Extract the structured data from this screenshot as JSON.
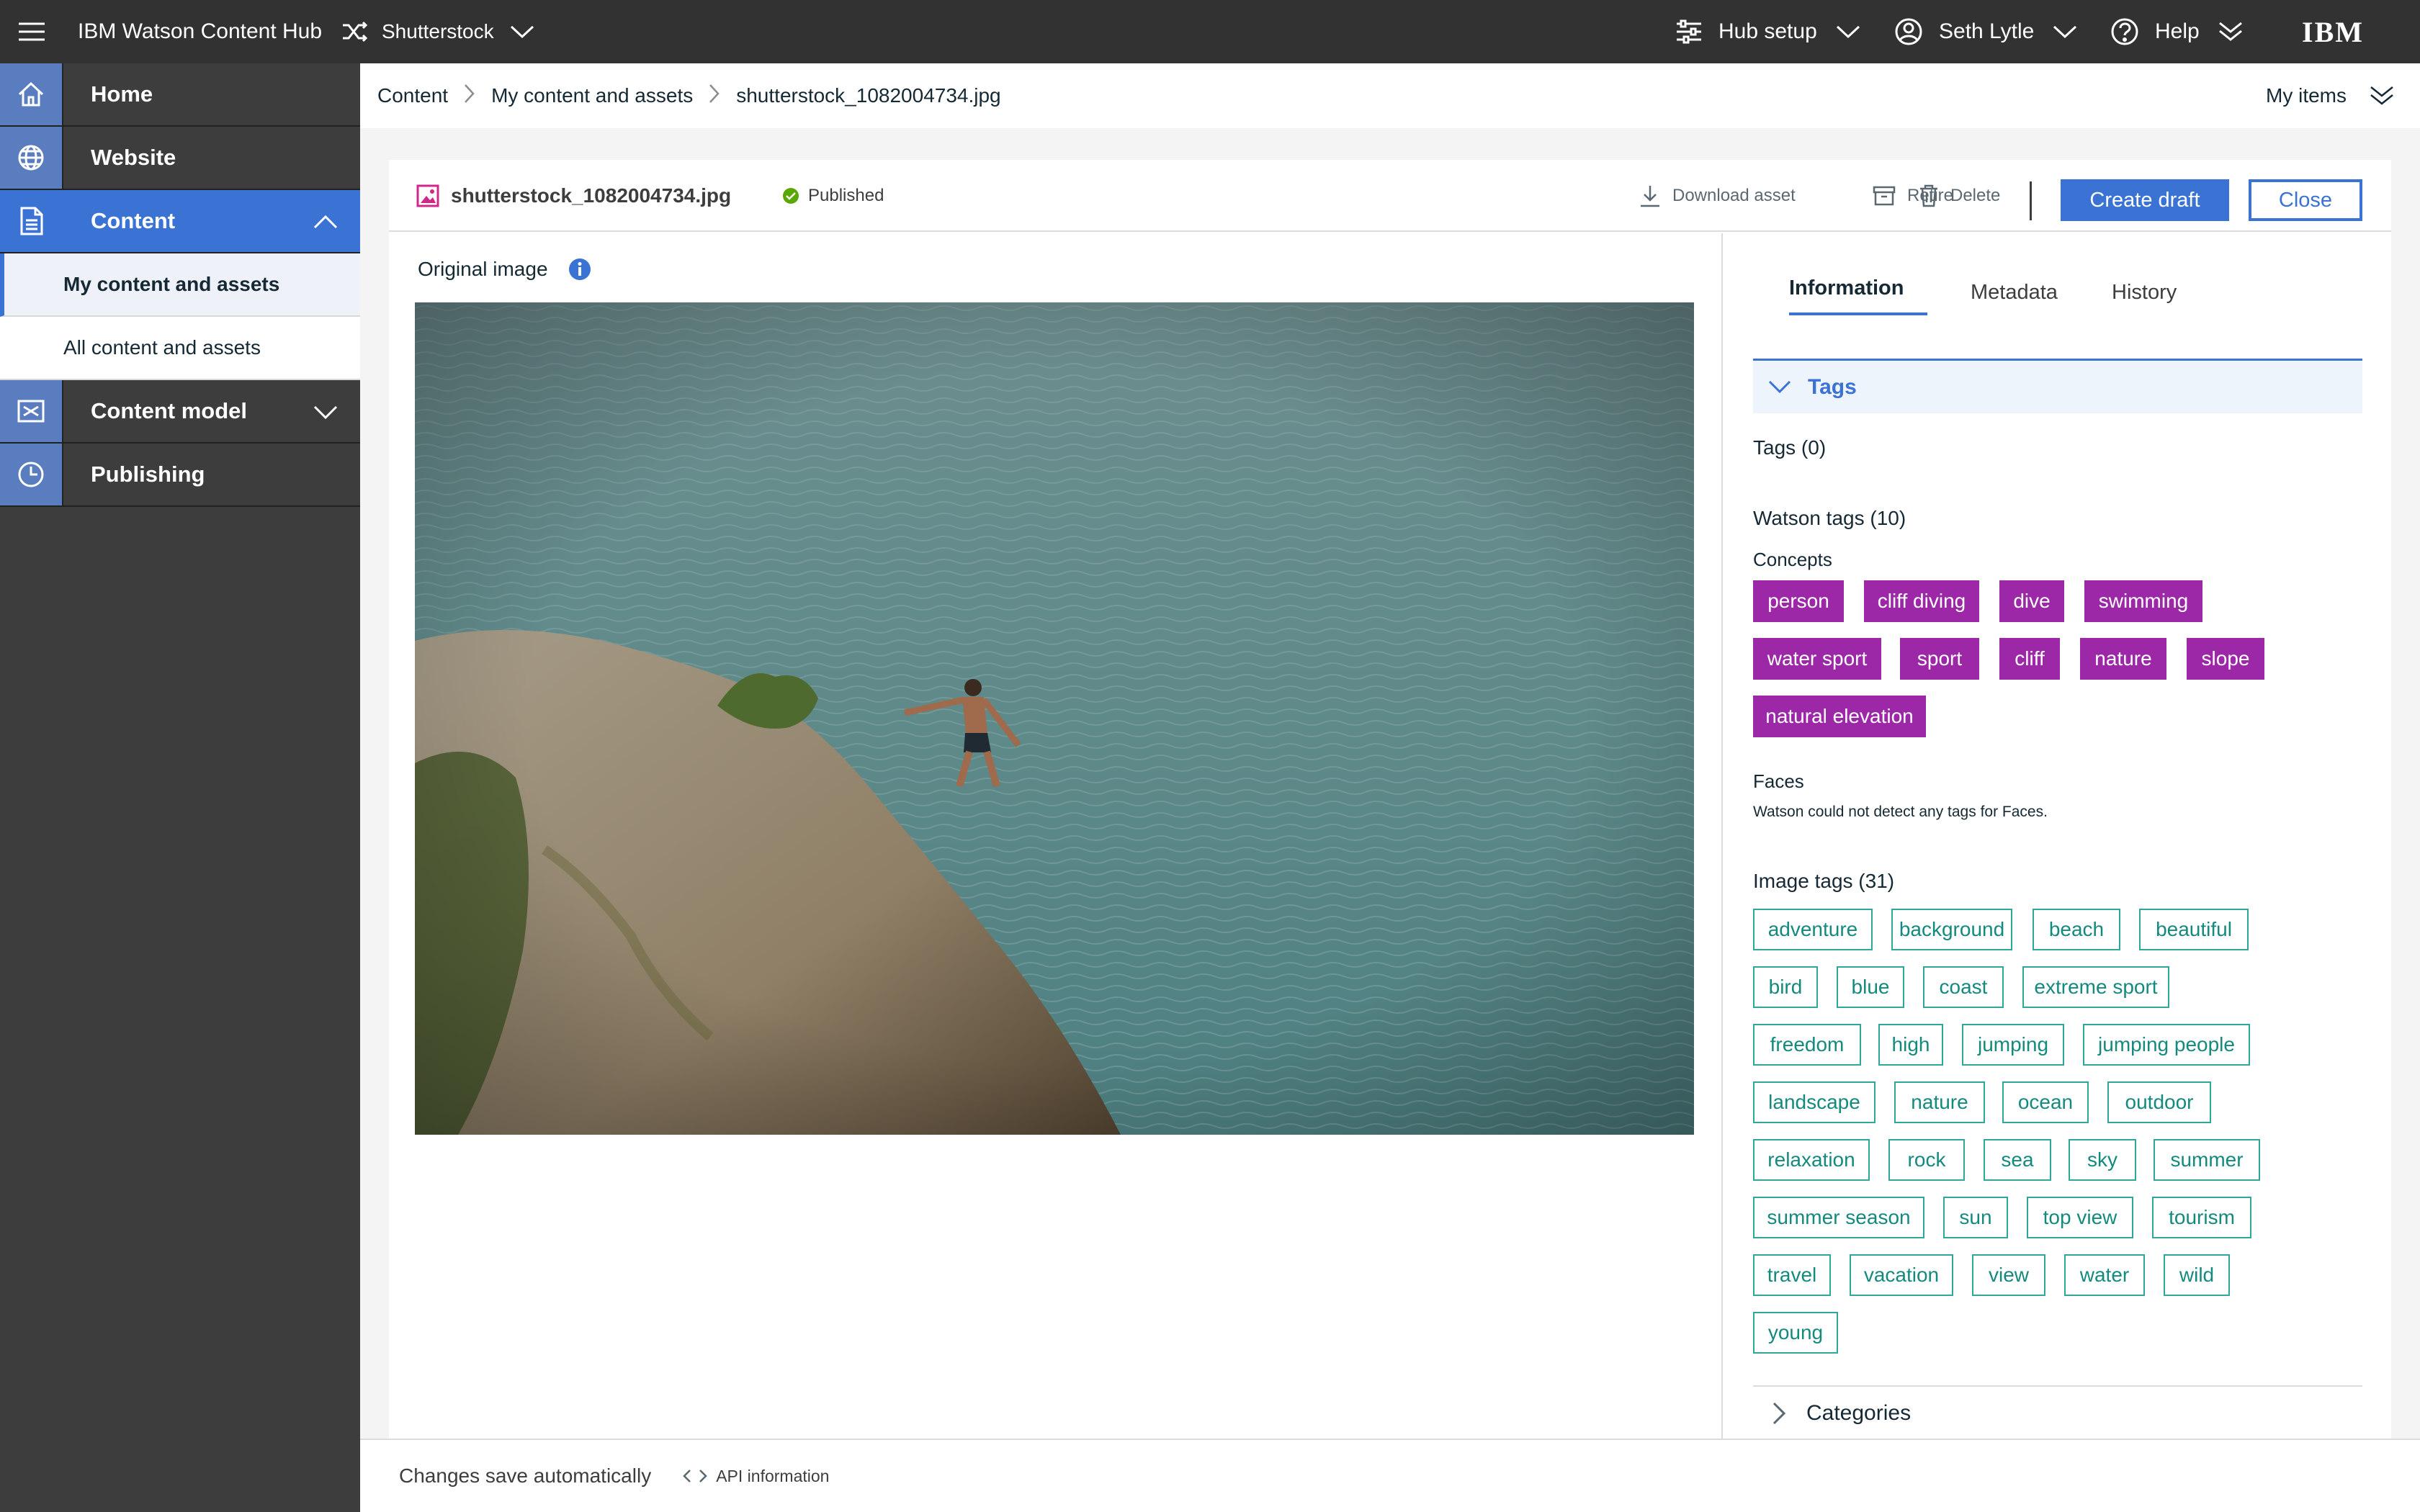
{
  "app": {
    "title": "IBM Watson Content Hub",
    "source": "Shutterstock",
    "hub_setup": "Hub setup",
    "user": "Seth Lytle",
    "help": "Help",
    "logo": "IBM"
  },
  "sidebar": {
    "items": [
      {
        "label": "Home",
        "icon": "home-icon"
      },
      {
        "label": "Website",
        "icon": "globe-icon"
      },
      {
        "label": "Content",
        "icon": "document-icon",
        "expanded": true
      },
      {
        "label": "Content model",
        "icon": "model-icon"
      },
      {
        "label": "Publishing",
        "icon": "clock-icon"
      }
    ],
    "sub": [
      "My content and assets",
      "All content and assets"
    ]
  },
  "breadcrumb": [
    "Content",
    "My content and assets",
    "shutterstock_1082004734.jpg"
  ],
  "my_items": "My items",
  "asset": {
    "filename": "shutterstock_1082004734.jpg",
    "status": "Published",
    "status_color": "#5aa700"
  },
  "toolbar": {
    "download": "Download asset",
    "retire": "Retire",
    "delete": "Delete",
    "create_draft": "Create draft",
    "close": "Close"
  },
  "preview": {
    "label": "Original image"
  },
  "tabs": [
    "Information",
    "Metadata",
    "History"
  ],
  "tags": {
    "section": "Tags",
    "count_label": "Tags (0)",
    "watson_label": "Watson tags (10)",
    "concepts_label": "Concepts",
    "concepts": [
      "person",
      "cliff diving",
      "dive",
      "swimming",
      "water sport",
      "sport",
      "cliff",
      "nature",
      "slope",
      "natural elevation"
    ],
    "faces_label": "Faces",
    "faces_text": "Watson could not detect any tags for Faces.",
    "image_tags_label": "Image tags (31)",
    "image_tags": [
      "adventure",
      "background",
      "beach",
      "beautiful",
      "bird",
      "blue",
      "coast",
      "extreme sport",
      "freedom",
      "high",
      "jumping",
      "jumping people",
      "landscape",
      "nature",
      "ocean",
      "outdoor",
      "relaxation",
      "rock",
      "sea",
      "sky",
      "summer",
      "summer season",
      "sun",
      "top view",
      "tourism",
      "travel",
      "vacation",
      "view",
      "water",
      "wild",
      "young"
    ]
  },
  "categories": "Categories",
  "footer": {
    "autosave": "Changes save automatically",
    "api": "API information"
  },
  "colors": {
    "accent": "#3b73d4",
    "concept": "#9c28a8",
    "tag": "#2ea89a"
  }
}
